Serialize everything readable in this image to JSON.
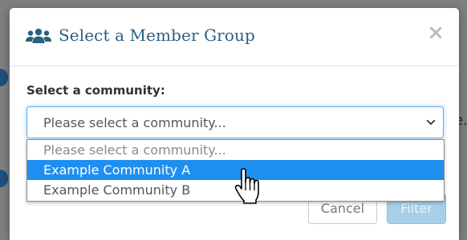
{
  "background": {
    "partial_text": "e."
  },
  "dialog": {
    "title": "Select a Member Group",
    "title_icon": "users-icon",
    "close_symbol": "×",
    "field_label": "Select a community:",
    "select": {
      "current_value": "Please select a community...",
      "options": [
        {
          "label": "Please select a community...",
          "state": "placeholder"
        },
        {
          "label": "Example Community A",
          "state": "highlighted"
        },
        {
          "label": "Example Community B",
          "state": "normal"
        }
      ]
    },
    "buttons": {
      "cancel": "Cancel",
      "filter": "Filter"
    }
  },
  "colors": {
    "title": "#2b5f80",
    "highlight": "#1e8ff0",
    "focus_border": "#66afe9",
    "filter_button": "#a7cfea"
  }
}
